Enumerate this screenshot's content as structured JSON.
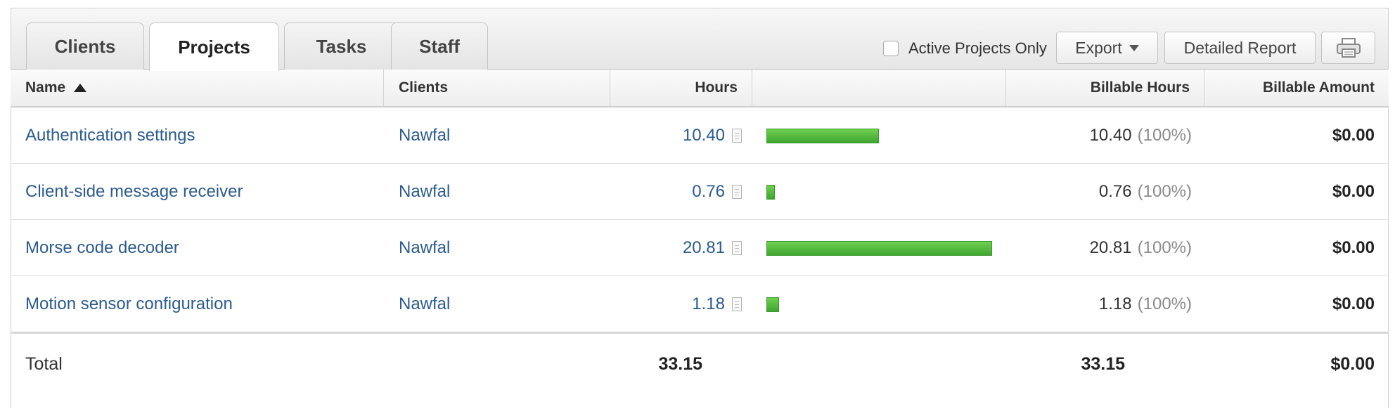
{
  "tabs": [
    "Clients",
    "Projects",
    "Tasks",
    "Staff"
  ],
  "active_tab": "Projects",
  "filters": {
    "active_only_label": "Active Projects Only",
    "active_only_checked": false
  },
  "toolbar": {
    "export_label": "Export",
    "detailed_report_label": "Detailed Report",
    "print_icon": "printer-icon"
  },
  "columns": {
    "name": "Name",
    "clients": "Clients",
    "hours": "Hours",
    "billable_hours": "Billable Hours",
    "billable_amount": "Billable Amount"
  },
  "sort": {
    "column": "Name",
    "direction": "ascending"
  },
  "rows": [
    {
      "name": "Authentication settings",
      "client": "Nawfal",
      "hours": "10.40",
      "hours_value": 10.4,
      "billable_hours": "10.40",
      "billable_pct": "(100%)",
      "billable_amount": "$0.00"
    },
    {
      "name": "Client-side message receiver",
      "client": "Nawfal",
      "hours": "0.76",
      "hours_value": 0.76,
      "billable_hours": "0.76",
      "billable_pct": "(100%)",
      "billable_amount": "$0.00"
    },
    {
      "name": "Morse code decoder",
      "client": "Nawfal",
      "hours": "20.81",
      "hours_value": 20.81,
      "billable_hours": "20.81",
      "billable_pct": "(100%)",
      "billable_amount": "$0.00"
    },
    {
      "name": "Motion sensor configuration",
      "client": "Nawfal",
      "hours": "1.18",
      "hours_value": 1.18,
      "billable_hours": "1.18",
      "billable_pct": "(100%)",
      "billable_amount": "$0.00"
    }
  ],
  "total": {
    "label": "Total",
    "hours": "33.15",
    "billable_hours": "33.15",
    "billable_amount": "$0.00"
  },
  "colors": {
    "link": "#2a5b8f",
    "bar": "#4cb83a",
    "muted": "#8a8a8a"
  }
}
